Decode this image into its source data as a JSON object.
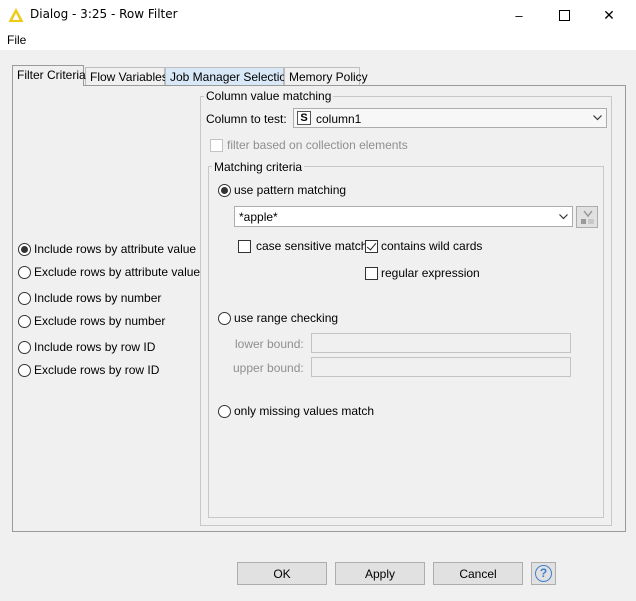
{
  "window": {
    "title": "Dialog - 3:25 - Row Filter",
    "minimize_symbol": "–",
    "close_symbol": "✕"
  },
  "menu": {
    "file": "File"
  },
  "tabs": [
    {
      "label": "Filter Criteria"
    },
    {
      "label": "Flow Variables"
    },
    {
      "label": "Job Manager Selection"
    },
    {
      "label": "Memory Policy"
    }
  ],
  "filter_modes": [
    {
      "label": "Include rows by attribute value",
      "selected": true
    },
    {
      "label": "Exclude rows by attribute value",
      "selected": false
    },
    {
      "label": "Include rows by number",
      "selected": false
    },
    {
      "label": "Exclude rows by number",
      "selected": false
    },
    {
      "label": "Include rows by row ID",
      "selected": false
    },
    {
      "label": "Exclude rows by row ID",
      "selected": false
    }
  ],
  "column_matching": {
    "group_title": "Column value matching",
    "column_label": "Column to test:",
    "column_type_badge": "S",
    "column_value": "column1",
    "collection_label": "filter based on collection elements"
  },
  "criteria": {
    "group_title": "Matching criteria",
    "pattern_label": "use pattern matching",
    "pattern_value": "*apple*",
    "case_sensitive_label": "case sensitive match",
    "wildcards_label": "contains wild cards",
    "regex_label": "regular expression",
    "range_label": "use range checking",
    "lower_label": "lower bound:",
    "upper_label": "upper bound:",
    "missing_label": "only missing values match"
  },
  "buttons": {
    "ok": "OK",
    "apply": "Apply",
    "cancel": "Cancel",
    "help": "?"
  },
  "colors": {
    "accent_blue": "#3c7fd0",
    "warning_yellow": "#f2c811"
  }
}
